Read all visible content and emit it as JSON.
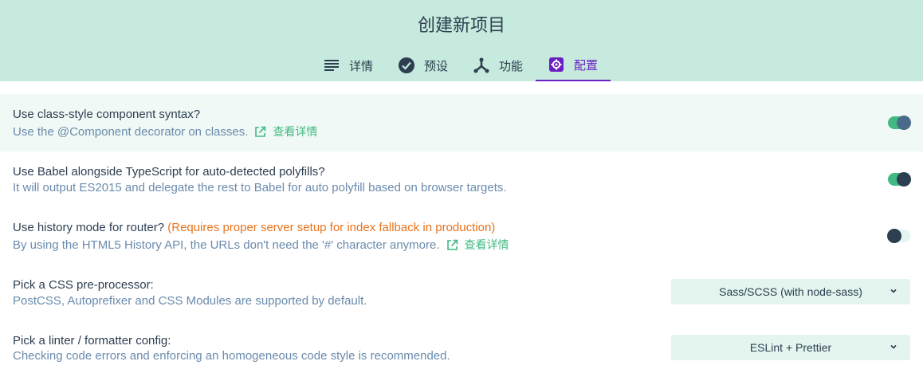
{
  "header": {
    "title": "创建新项目",
    "tabs": [
      {
        "label": "详情",
        "icon": "list-icon"
      },
      {
        "label": "预设",
        "icon": "check-circle-icon"
      },
      {
        "label": "功能",
        "icon": "fork-icon"
      },
      {
        "label": "配置",
        "icon": "gear-icon",
        "active": true
      }
    ]
  },
  "options": [
    {
      "question": "Use class-style component syntax?",
      "description": "Use the @Component decorator on classes.",
      "link": "查看详情",
      "toggle": "on",
      "knob_color": "#4a6a8a"
    },
    {
      "question": "Use Babel alongside TypeScript for auto-detected polyfills?",
      "description": "It will output ES2015 and delegate the rest to Babel for auto polyfill based on browser targets.",
      "toggle": "on",
      "knob_color": "#2c3e50"
    },
    {
      "question": "Use history mode for router?",
      "warning": "(Requires proper server setup for index fallback in production)",
      "description": "By using the HTML5 History API, the URLs don't need the '#' character anymore.",
      "link": "查看详情",
      "toggle": "off"
    },
    {
      "question": "Pick a CSS pre-processor:",
      "description": "PostCSS, Autoprefixer and CSS Modules are supported by default.",
      "select_value": "Sass/SCSS (with node-sass)"
    },
    {
      "question": "Pick a linter / formatter config:",
      "description": "Checking code errors and enforcing an homogeneous code style is recommended.",
      "select_value": "ESLint + Prettier"
    }
  ],
  "colors": {
    "header_bg": "#c6eadd",
    "accent": "#42b983",
    "active_tab": "#6a1fc2",
    "warning": "#e8731e",
    "description": "#6a8bad",
    "text": "#2c3e50"
  }
}
